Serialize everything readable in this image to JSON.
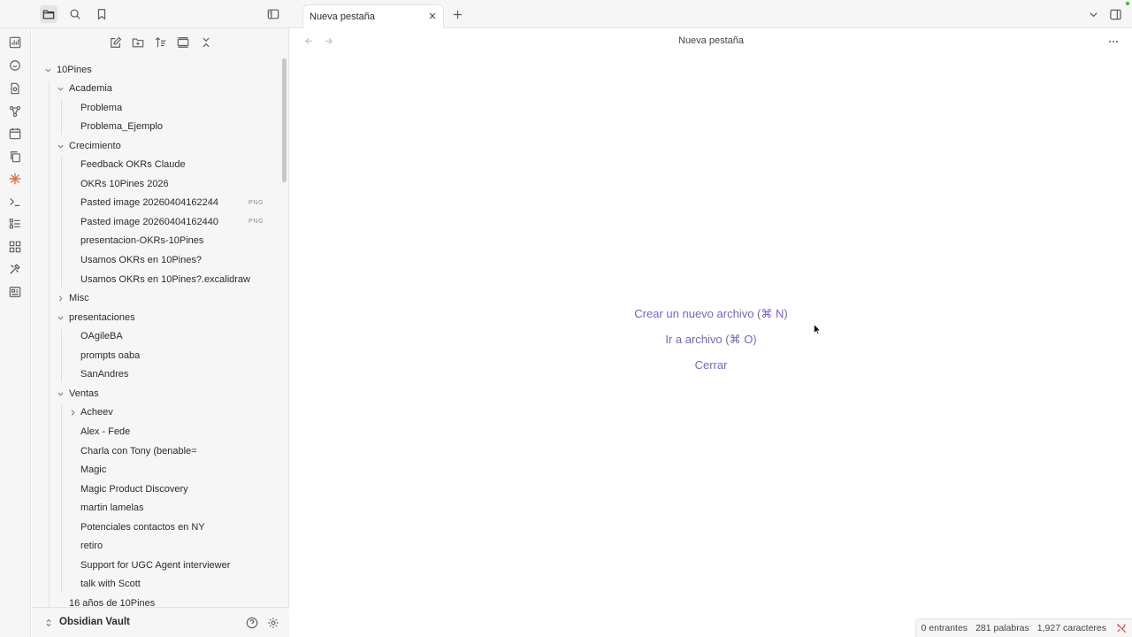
{
  "sidebar_top": {
    "icons": [
      "folder-icon",
      "search-icon",
      "bookmark-icon"
    ],
    "toggle_icon": "sidebar-toggle-icon"
  },
  "ribbon": {
    "icons": [
      "dashboard-icon",
      "daily-note-icon",
      "file-icon",
      "graph-icon",
      "calendar-icon",
      "copy-icon",
      "claude-icon",
      "terminal-icon",
      "tasks-icon",
      "plugins-icon",
      "tools-icon",
      "canvas-icon"
    ]
  },
  "nav_actions": [
    "new-note-icon",
    "new-folder-icon",
    "sort-icon",
    "collapse-view-icon",
    "collapse-all-icon"
  ],
  "tree": [
    {
      "label": "10Pines",
      "depth": 0,
      "type": "folder",
      "open": true
    },
    {
      "label": "Academia",
      "depth": 1,
      "type": "folder",
      "open": true
    },
    {
      "label": "Problema",
      "depth": 2,
      "type": "file"
    },
    {
      "label": "Problema_Ejemplo",
      "depth": 2,
      "type": "file"
    },
    {
      "label": "Crecimiento",
      "depth": 1,
      "type": "folder",
      "open": true
    },
    {
      "label": "Feedback OKRs Claude",
      "depth": 2,
      "type": "file"
    },
    {
      "label": "OKRs 10Pines 2026",
      "depth": 2,
      "type": "file"
    },
    {
      "label": "Pasted image 20260404162244",
      "depth": 2,
      "type": "file",
      "ext": "PNG"
    },
    {
      "label": "Pasted image 20260404162440",
      "depth": 2,
      "type": "file",
      "ext": "PNG"
    },
    {
      "label": "presentacion-OKRs-10Pines",
      "depth": 2,
      "type": "file"
    },
    {
      "label": "Usamos OKRs en 10Pines?",
      "depth": 2,
      "type": "file"
    },
    {
      "label": "Usamos OKRs en 10Pines?.excalidraw",
      "depth": 2,
      "type": "file"
    },
    {
      "label": "Misc",
      "depth": 1,
      "type": "folder",
      "open": false
    },
    {
      "label": "presentaciones",
      "depth": 1,
      "type": "folder",
      "open": true
    },
    {
      "label": "OAgileBA",
      "depth": 2,
      "type": "file"
    },
    {
      "label": "prompts oaba",
      "depth": 2,
      "type": "file"
    },
    {
      "label": "SanAndres",
      "depth": 2,
      "type": "file"
    },
    {
      "label": "Ventas",
      "depth": 1,
      "type": "folder",
      "open": true
    },
    {
      "label": "Acheev",
      "depth": 2,
      "type": "folder",
      "open": false
    },
    {
      "label": "Alex - Fede",
      "depth": 2,
      "type": "file"
    },
    {
      "label": "Charla con Tony (benable=",
      "depth": 2,
      "type": "file"
    },
    {
      "label": "Magic",
      "depth": 2,
      "type": "file"
    },
    {
      "label": "Magic Product Discovery",
      "depth": 2,
      "type": "file"
    },
    {
      "label": "martin lamelas",
      "depth": 2,
      "type": "file"
    },
    {
      "label": "Potenciales contactos en NY",
      "depth": 2,
      "type": "file"
    },
    {
      "label": "retiro",
      "depth": 2,
      "type": "file"
    },
    {
      "label": "Support for UGC Agent interviewer",
      "depth": 2,
      "type": "file"
    },
    {
      "label": "talk with Scott",
      "depth": 2,
      "type": "file"
    },
    {
      "label": "16 años de 10Pines",
      "depth": 1,
      "type": "file"
    }
  ],
  "vault": {
    "name": "Obsidian Vault",
    "icons": [
      "help-icon",
      "settings-icon"
    ]
  },
  "tabs": [
    {
      "label": "Nueva pestaña"
    }
  ],
  "view": {
    "title": "Nueva pestaña",
    "actions": [
      {
        "label": "Crear un nuevo archivo (⌘ N)"
      },
      {
        "label": "Ir a archivo (⌘ O)"
      },
      {
        "label": "Cerrar"
      }
    ]
  },
  "status_bar": {
    "backlinks": "0 entrantes",
    "words": "281 palabras",
    "chars": "1,927 caracteres"
  },
  "colors": {
    "accent": "#7b62c9",
    "sync_error": "#d04545",
    "claude": "#e0714f",
    "green_dot": "#3bb54a"
  }
}
